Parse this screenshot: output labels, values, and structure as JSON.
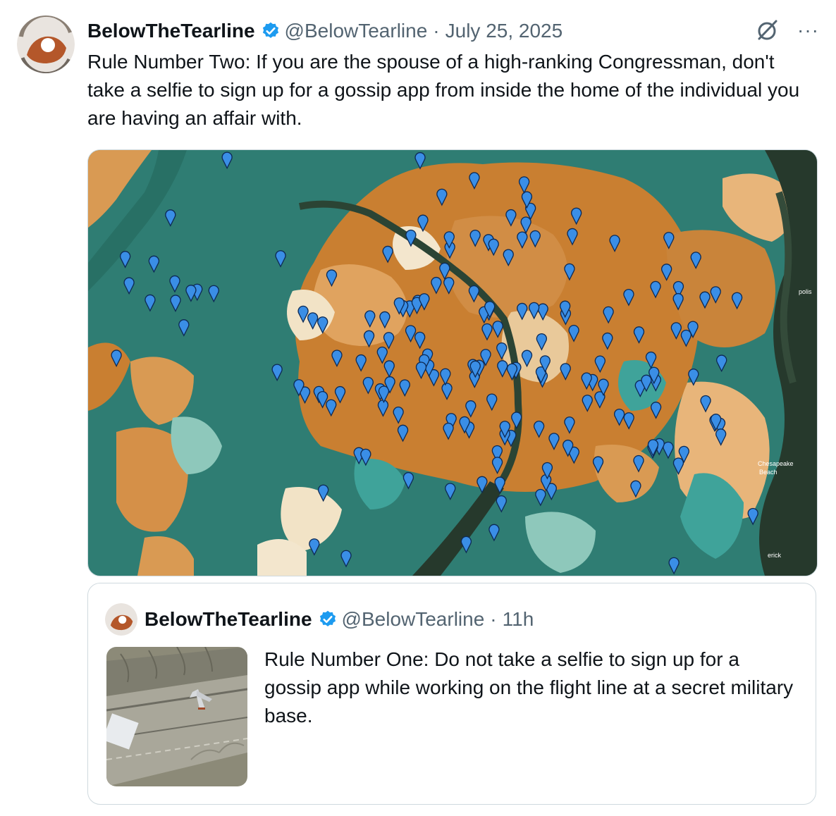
{
  "tweet": {
    "author_name": "BelowTheTearline",
    "handle": "@BelowTearline",
    "separator": "·",
    "date": "July 25, 2025",
    "text": "Rule Number Two: If you are the spouse of a high-ranking Congressman, don't take a selfie to sign up for a gossip app from inside the home of the individual you are having an affair with.",
    "more_label": "···"
  },
  "map": {
    "labels": [
      "Chesapeake",
      "Beach",
      "erick",
      "polis"
    ]
  },
  "quoted_tweet": {
    "author_name": "BelowTheTearline",
    "handle": "@BelowTearline",
    "separator": "·",
    "time": "11h",
    "text": "Rule Number One: Do not take a selfie to sign up for a gossip app while working on the flight line at a secret military base."
  },
  "colors": {
    "accent": "#1d9bf0",
    "text_secondary": "#536471",
    "border": "#cfd9de",
    "map_teal": "#2f7d73",
    "map_orange": "#d4883a",
    "map_water": "#26392c"
  },
  "icons": [
    "verified-badge-icon",
    "grok-icon",
    "more-icon",
    "map-pin-icon"
  ]
}
